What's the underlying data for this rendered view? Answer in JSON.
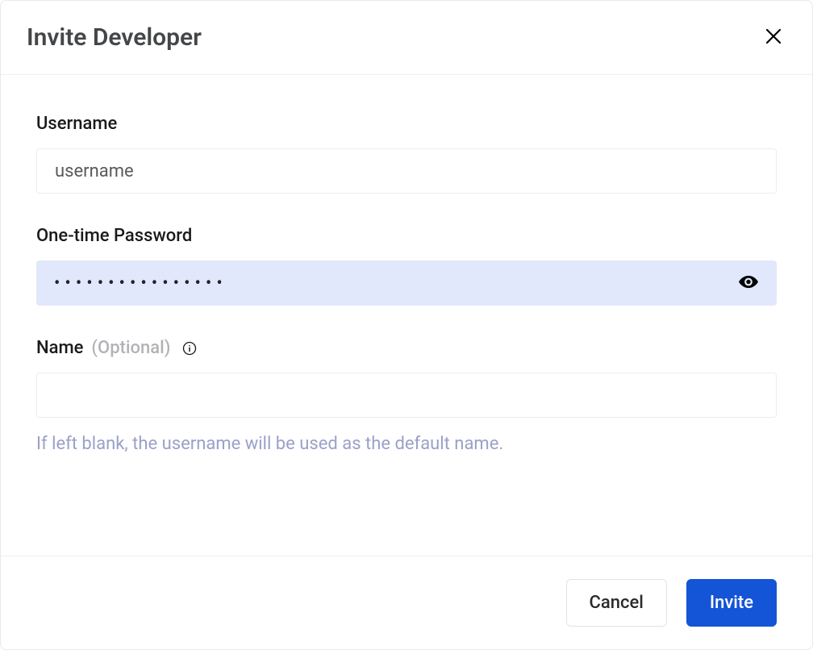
{
  "modal": {
    "title": "Invite Developer",
    "fields": {
      "username": {
        "label": "Username",
        "placeholder": "username",
        "value": ""
      },
      "password": {
        "label": "One-time Password",
        "mask": "••••••••••••••••"
      },
      "name": {
        "label": "Name",
        "optional_label": "(Optional)",
        "value": "",
        "helper": "If left blank, the username will be used as the default name."
      }
    },
    "footer": {
      "cancel": "Cancel",
      "invite": "Invite"
    }
  }
}
